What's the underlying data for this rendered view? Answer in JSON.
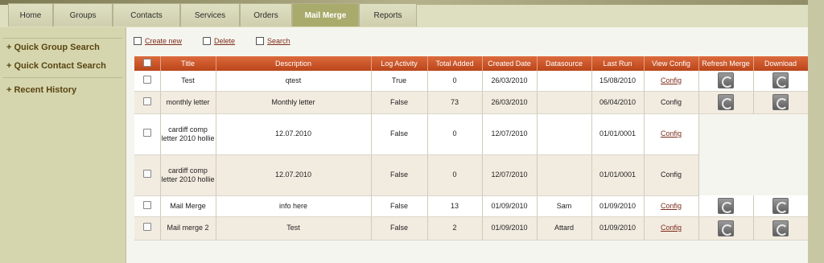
{
  "tabs": [
    "Home",
    "Groups",
    "Contacts",
    "Services",
    "Orders",
    "Mail Merge",
    "Reports"
  ],
  "sidebar": [
    "+ Quick Group Search",
    "+ Quick Contact Search",
    "+ Recent History"
  ],
  "actions": {
    "create": "Create new",
    "delete": "Delete",
    "search": "Search"
  },
  "table": {
    "headers": [
      "Title",
      "Description",
      "Log Activity",
      "Total Added",
      "Created Date",
      "Datasource",
      "Last Run",
      "View Config",
      "Refresh Merge",
      "Download"
    ],
    "rows": [
      {
        "title": "Test",
        "description": "qtest",
        "log": "True",
        "total": "0",
        "created": "26/03/2010",
        "datasource": "",
        "lastrun": "15/08/2010",
        "config": "Config"
      },
      {
        "title": "monthly letter",
        "description": "Monthly letter",
        "log": "False",
        "total": "73",
        "created": "26/03/2010",
        "datasource": "",
        "lastrun": "06/04/2010",
        "config": "Config"
      },
      {
        "title": "cardiff comp letter 2010 hollie",
        "description": "12.07.2010",
        "log": "False",
        "total": "0",
        "created": "12/07/2010",
        "datasource": "",
        "lastrun": "01/01/0001",
        "config": "Config"
      },
      {
        "title": "cardiff comp letter 2010 hollie",
        "description": "12.07.2010",
        "log": "False",
        "total": "0",
        "created": "12/07/2010",
        "datasource": "",
        "lastrun": "01/01/0001",
        "config": "Config"
      },
      {
        "title": "Mail Merge",
        "description": "info here",
        "log": "False",
        "total": "13",
        "created": "01/09/2010",
        "datasource": "Sam",
        "lastrun": "01/09/2010",
        "config": "Config"
      },
      {
        "title": "Mail merge 2",
        "description": "Test",
        "log": "False",
        "total": "2",
        "created": "01/09/2010",
        "datasource": "Attard",
        "lastrun": "01/09/2010",
        "config": "Config"
      }
    ]
  },
  "colors": {
    "header_orange": "#c9532a",
    "link": "#7d2d1b",
    "active_tab": "#a9ab6c"
  }
}
